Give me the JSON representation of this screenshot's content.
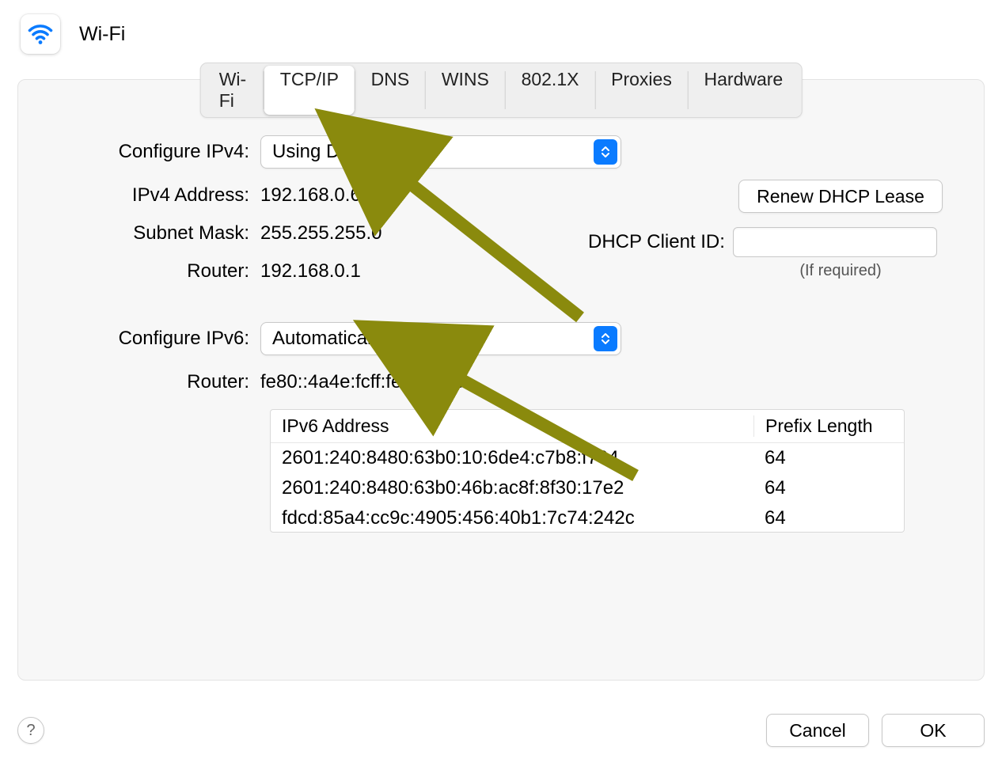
{
  "header": {
    "title": "Wi-Fi"
  },
  "tabs": [
    "Wi-Fi",
    "TCP/IP",
    "DNS",
    "WINS",
    "802.1X",
    "Proxies",
    "Hardware"
  ],
  "active_tab_index": 1,
  "ipv4": {
    "configure_label": "Configure IPv4:",
    "configure_value": "Using DHCP",
    "address_label": "IPv4 Address:",
    "address_value": "192.168.0.6",
    "subnet_label": "Subnet Mask:",
    "subnet_value": "255.255.255.0",
    "router_label": "Router:",
    "router_value": "192.168.0.1",
    "renew_button": "Renew DHCP Lease",
    "dhcp_client_id_label": "DHCP Client ID:",
    "dhcp_client_id_value": "",
    "dhcp_client_id_hint": "(If required)"
  },
  "ipv6": {
    "configure_label": "Configure IPv6:",
    "configure_value": "Automatically",
    "router_label": "Router:",
    "router_value": "fe80::4a4e:fcff:feb4:40fc",
    "table": {
      "col_address": "IPv6 Address",
      "col_prefix": "Prefix Length",
      "rows": [
        {
          "addr": "2601:240:8480:63b0:10:6de4:c7b8:f704",
          "prefix": "64"
        },
        {
          "addr": "2601:240:8480:63b0:46b:ac8f:8f30:17e2",
          "prefix": "64"
        },
        {
          "addr": "fdcd:85a4:cc9c:4905:456:40b1:7c74:242c",
          "prefix": "64"
        }
      ]
    }
  },
  "footer": {
    "help": "?",
    "cancel": "Cancel",
    "ok": "OK"
  },
  "annotations": {
    "arrow_color": "#8a8a0d"
  }
}
